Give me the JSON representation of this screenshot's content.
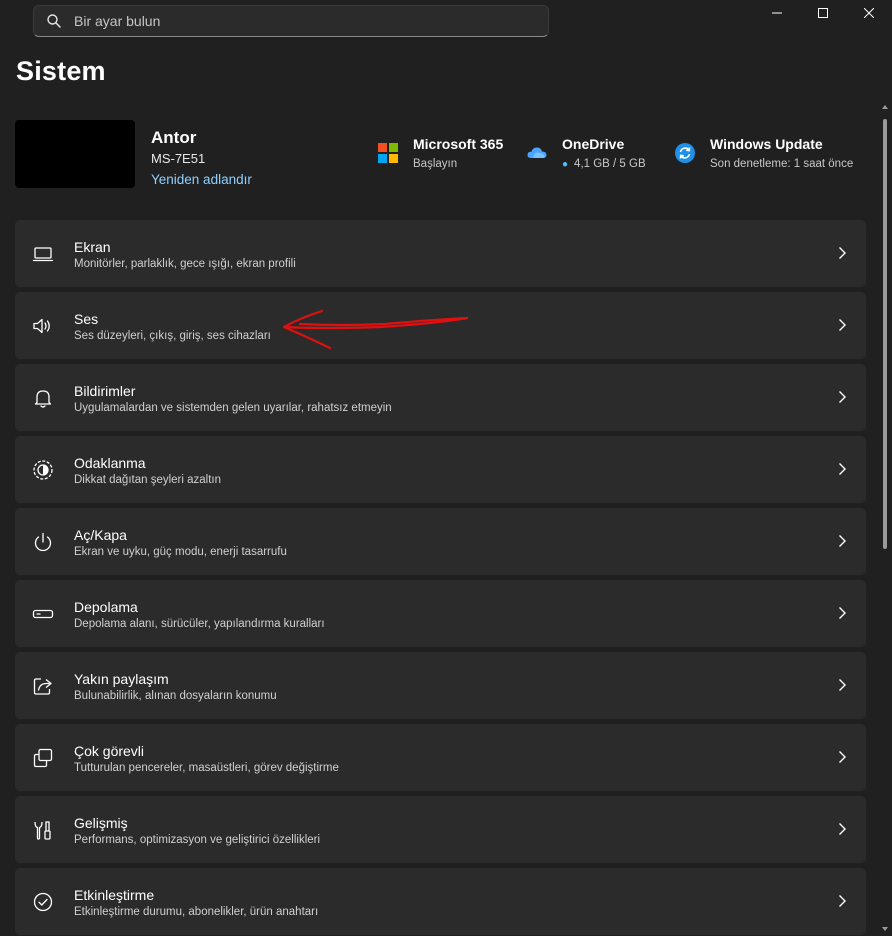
{
  "search": {
    "placeholder": "Bir ayar bulun"
  },
  "window_controls": [
    "minimize",
    "maximize",
    "close"
  ],
  "page": {
    "title": "Sistem"
  },
  "device": {
    "name": "Antor",
    "model": "MS-7E51",
    "rename_label": "Yeniden adlandır"
  },
  "tiles": [
    {
      "title": "Microsoft 365",
      "subtitle": "Başlayın",
      "icon": "microsoft-365-icon"
    },
    {
      "title": "OneDrive",
      "subtitle": "4,1 GB / 5 GB",
      "icon": "onedrive-cloud-icon"
    },
    {
      "title": "Windows Update",
      "subtitle": "Son denetleme: 1 saat önce",
      "icon": "windows-update-icon"
    }
  ],
  "items": [
    {
      "title": "Ekran",
      "subtitle": "Monitörler, parlaklık, gece ışığı, ekran profili",
      "icon": "display-icon"
    },
    {
      "title": "Ses",
      "subtitle": "Ses düzeyleri, çıkış, giriş, ses cihazları",
      "icon": "speaker-icon"
    },
    {
      "title": "Bildirimler",
      "subtitle": "Uygulamalardan ve sistemden gelen uyarılar, rahatsız etmeyin",
      "icon": "bell-icon"
    },
    {
      "title": "Odaklanma",
      "subtitle": "Dikkat dağıtan şeyleri azaltın",
      "icon": "focus-icon"
    },
    {
      "title": "Aç/Kapa",
      "subtitle": "Ekran ve uyku, güç modu, enerji tasarrufu",
      "icon": "power-icon"
    },
    {
      "title": "Depolama",
      "subtitle": "Depolama alanı, sürücüler, yapılandırma kuralları",
      "icon": "storage-icon"
    },
    {
      "title": "Yakın paylaşım",
      "subtitle": "Bulunabilirlik, alınan dosyaların konumu",
      "icon": "share-icon"
    },
    {
      "title": "Çok görevli",
      "subtitle": "Tutturulan pencereler, masaüstleri, görev değiştirme",
      "icon": "multitasking-icon"
    },
    {
      "title": "Gelişmiş",
      "subtitle": "Performans, optimizasyon ve geliştirici özellikleri",
      "icon": "tools-icon"
    },
    {
      "title": "Etkinleştirme",
      "subtitle": "Etkinleştirme durumu, abonelikler, ürün anahtarı",
      "icon": "check-circle-icon"
    }
  ],
  "colors": {
    "background": "#202020",
    "card": "#2b2b2b",
    "accent_link": "#8fd0ff",
    "annotation_arrow": "#e01010"
  }
}
